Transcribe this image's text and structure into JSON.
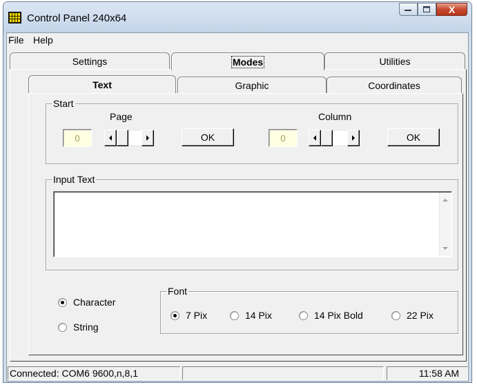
{
  "window": {
    "title": "Control Panel 240x64",
    "minimize_glyph": "—",
    "maximize_glyph": "▢",
    "close_glyph": "X"
  },
  "menu": {
    "items": [
      "File",
      "Help"
    ]
  },
  "outer_tabs": [
    {
      "label": "Settings",
      "active": false
    },
    {
      "label": "Modes",
      "active": true
    },
    {
      "label": "Utilities",
      "active": false
    }
  ],
  "inner_tabs": [
    {
      "label": "Text",
      "active": true
    },
    {
      "label": "Graphic",
      "active": false
    },
    {
      "label": "Coordinates",
      "active": false
    }
  ],
  "start_group": {
    "legend": "Start",
    "page": {
      "label": "Page",
      "value": "0",
      "ok_label": "OK"
    },
    "column": {
      "label": "Column",
      "value": "0",
      "ok_label": "OK"
    }
  },
  "input_group": {
    "legend": "Input Text",
    "value": ""
  },
  "mode_options": [
    {
      "label": "Character",
      "checked": true
    },
    {
      "label": "String",
      "checked": false
    }
  ],
  "font_group": {
    "legend": "Font",
    "options": [
      {
        "label": "7 Pix",
        "checked": true
      },
      {
        "label": "14 Pix",
        "checked": false
      },
      {
        "label": "14 Pix Bold",
        "checked": false
      },
      {
        "label": "22 Pix",
        "checked": false
      }
    ]
  },
  "status": {
    "connection": "Connected: COM6 9600,n,8,1",
    "middle": "",
    "time": "11:58 AM"
  },
  "icons": {
    "arrow_left": "left-arrow-icon",
    "arrow_right": "right-arrow-icon",
    "arrow_up": "up-arrow-icon",
    "arrow_down": "down-arrow-icon",
    "app": "grid-app-icon"
  },
  "colors": {
    "field_bg": "#ffffe1",
    "close_button": "#c74a2f",
    "frame": "#cfdceb"
  }
}
